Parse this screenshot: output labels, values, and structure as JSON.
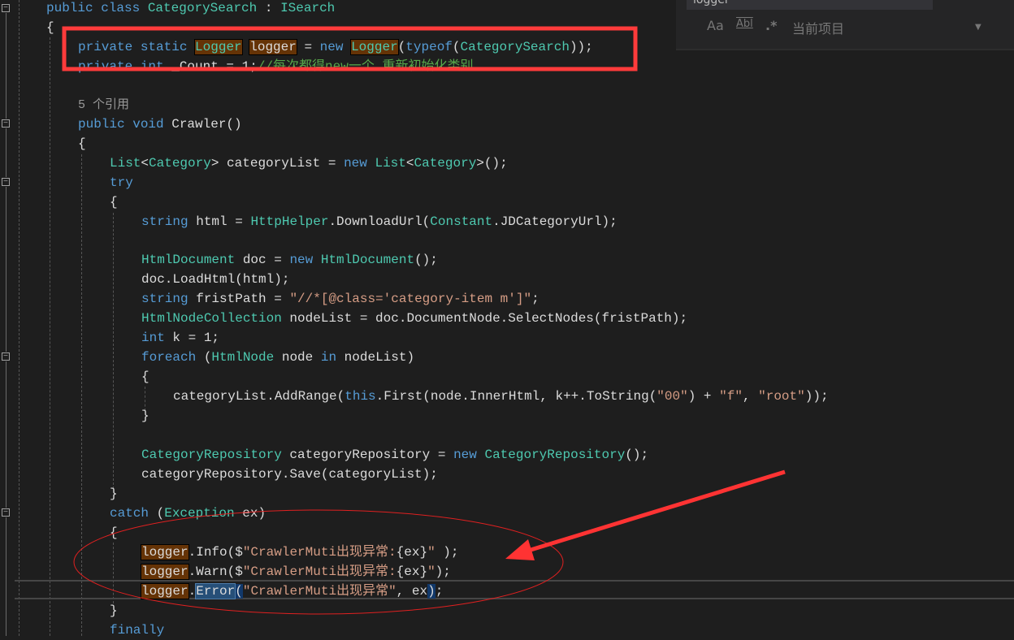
{
  "find_panel": {
    "query": "logger",
    "match_case": "Aa",
    "whole_word": "Abl",
    "regex": ".*",
    "scope": "当前项目"
  },
  "code_lines": [
    {
      "indent": 0,
      "tokens": [
        [
          "kw",
          "public class "
        ],
        [
          "ty",
          "CategorySearch"
        ],
        [
          "tx",
          " : "
        ],
        [
          "ty",
          "ISearch"
        ]
      ]
    },
    {
      "indent": 0,
      "tokens": [
        [
          "tx",
          "{"
        ]
      ]
    },
    {
      "indent": 1,
      "tokens": [
        [
          "kw",
          "private static "
        ],
        [
          "ty hl",
          "Logger"
        ],
        [
          "tx",
          " "
        ],
        [
          "tx hl",
          "logger"
        ],
        [
          "tx",
          " = "
        ],
        [
          "kw",
          "new "
        ],
        [
          "ty hl",
          "Logger"
        ],
        [
          "tx",
          "("
        ],
        [
          "kw",
          "typeof"
        ],
        [
          "tx",
          "("
        ],
        [
          "ty",
          "CategorySearch"
        ],
        [
          "tx",
          "));"
        ]
      ]
    },
    {
      "indent": 1,
      "tokens": [
        [
          "kw",
          "private int "
        ],
        [
          "tx",
          "_Count = 1;"
        ],
        [
          "cm",
          "//每次都得new一个 重新初始化类别"
        ]
      ]
    },
    {
      "indent": 1,
      "tokens": []
    },
    {
      "indent": 1,
      "tokens": [
        [
          "lens",
          "5 个引用"
        ]
      ]
    },
    {
      "indent": 1,
      "tokens": [
        [
          "kw",
          "public void "
        ],
        [
          "tx",
          "Crawler()"
        ]
      ]
    },
    {
      "indent": 1,
      "tokens": [
        [
          "tx",
          "{"
        ]
      ]
    },
    {
      "indent": 2,
      "tokens": [
        [
          "ty",
          "List"
        ],
        [
          "tx",
          "<"
        ],
        [
          "ty",
          "Category"
        ],
        [
          "tx",
          "> categoryList = "
        ],
        [
          "kw",
          "new "
        ],
        [
          "ty",
          "List"
        ],
        [
          "tx",
          "<"
        ],
        [
          "ty",
          "Category"
        ],
        [
          "tx",
          ">();"
        ]
      ]
    },
    {
      "indent": 2,
      "tokens": [
        [
          "kw",
          "try"
        ]
      ]
    },
    {
      "indent": 2,
      "tokens": [
        [
          "tx",
          "{"
        ]
      ]
    },
    {
      "indent": 3,
      "tokens": [
        [
          "kw",
          "string "
        ],
        [
          "tx",
          "html = "
        ],
        [
          "ty",
          "HttpHelper"
        ],
        [
          "tx",
          ".DownloadUrl("
        ],
        [
          "ty",
          "Constant"
        ],
        [
          "tx",
          ".JDCategoryUrl);"
        ]
      ]
    },
    {
      "indent": 3,
      "tokens": []
    },
    {
      "indent": 3,
      "tokens": [
        [
          "ty",
          "HtmlDocument"
        ],
        [
          "tx",
          " doc = "
        ],
        [
          "kw",
          "new "
        ],
        [
          "ty",
          "HtmlDocument"
        ],
        [
          "tx",
          "();"
        ]
      ]
    },
    {
      "indent": 3,
      "tokens": [
        [
          "tx",
          "doc.LoadHtml(html);"
        ]
      ]
    },
    {
      "indent": 3,
      "tokens": [
        [
          "kw",
          "string "
        ],
        [
          "tx",
          "fristPath = "
        ],
        [
          "st",
          "\"//*[@class='category-item m']\""
        ],
        [
          "tx",
          ";"
        ]
      ]
    },
    {
      "indent": 3,
      "tokens": [
        [
          "ty",
          "HtmlNodeCollection"
        ],
        [
          "tx",
          " nodeList = doc.DocumentNode.SelectNodes(fristPath);"
        ]
      ]
    },
    {
      "indent": 3,
      "tokens": [
        [
          "kw",
          "int "
        ],
        [
          "tx",
          "k = 1;"
        ]
      ]
    },
    {
      "indent": 3,
      "tokens": [
        [
          "kw",
          "foreach "
        ],
        [
          "tx",
          "("
        ],
        [
          "ty",
          "HtmlNode"
        ],
        [
          "tx",
          " node "
        ],
        [
          "kw",
          "in "
        ],
        [
          "tx",
          "nodeList)"
        ]
      ]
    },
    {
      "indent": 3,
      "tokens": [
        [
          "tx",
          "{"
        ]
      ]
    },
    {
      "indent": 4,
      "tokens": [
        [
          "tx",
          "categoryList.AddRange("
        ],
        [
          "kw",
          "this"
        ],
        [
          "tx",
          ".First(node.InnerHtml, k++.ToString("
        ],
        [
          "st",
          "\"00\""
        ],
        [
          "tx",
          ") + "
        ],
        [
          "st",
          "\"f\""
        ],
        [
          "tx",
          ", "
        ],
        [
          "st",
          "\"root\""
        ],
        [
          "tx",
          "));"
        ]
      ]
    },
    {
      "indent": 3,
      "tokens": [
        [
          "tx",
          "}"
        ]
      ]
    },
    {
      "indent": 3,
      "tokens": []
    },
    {
      "indent": 3,
      "tokens": [
        [
          "ty",
          "CategoryRepository"
        ],
        [
          "tx",
          " categoryRepository = "
        ],
        [
          "kw",
          "new "
        ],
        [
          "ty",
          "CategoryRepository"
        ],
        [
          "tx",
          "();"
        ]
      ]
    },
    {
      "indent": 3,
      "tokens": [
        [
          "tx",
          "categoryRepository.Save(categoryList);"
        ]
      ]
    },
    {
      "indent": 2,
      "tokens": [
        [
          "tx",
          "}"
        ]
      ]
    },
    {
      "indent": 2,
      "tokens": [
        [
          "kw",
          "catch "
        ],
        [
          "tx",
          "("
        ],
        [
          "ty",
          "Exception"
        ],
        [
          "tx",
          " ex)"
        ]
      ]
    },
    {
      "indent": 2,
      "tokens": [
        [
          "tx",
          "{"
        ]
      ]
    },
    {
      "indent": 3,
      "tokens": [
        [
          "tx hl",
          "logger"
        ],
        [
          "tx",
          ".Info($"
        ],
        [
          "st",
          "\"CrawlerMuti出现异常:"
        ],
        [
          "tx",
          "{ex}"
        ],
        [
          "st",
          "\" "
        ],
        [
          "tx",
          ");"
        ]
      ]
    },
    {
      "indent": 3,
      "tokens": [
        [
          "tx hl",
          "logger"
        ],
        [
          "tx",
          ".Warn($"
        ],
        [
          "st",
          "\"CrawlerMuti出现异常:"
        ],
        [
          "tx",
          "{ex}"
        ],
        [
          "st",
          "\""
        ],
        [
          "tx",
          ");"
        ]
      ]
    },
    {
      "indent": 3,
      "tokens": [
        [
          "tx hl",
          "logger"
        ],
        [
          "tx",
          "."
        ],
        [
          "tx sel",
          "Error"
        ],
        [
          "tx br",
          "("
        ],
        [
          "st",
          "\"CrawlerMuti出现异常\""
        ],
        [
          "tx",
          ", ex"
        ],
        [
          "tx br",
          ")"
        ],
        [
          "tx",
          ";"
        ]
      ]
    },
    {
      "indent": 2,
      "tokens": [
        [
          "tx",
          "}"
        ]
      ]
    },
    {
      "indent": 2,
      "tokens": [
        [
          "kw",
          "finally"
        ]
      ]
    }
  ]
}
